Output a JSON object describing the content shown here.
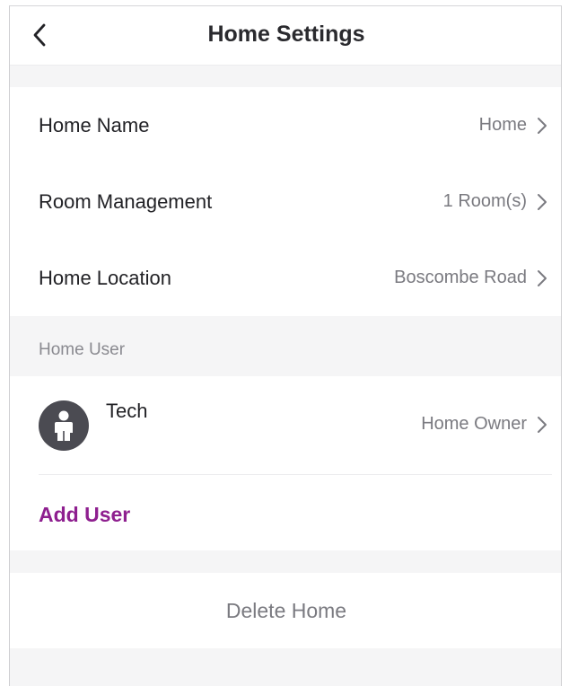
{
  "header": {
    "title": "Home Settings",
    "back_icon": "chevron-left-icon"
  },
  "settings": {
    "items": [
      {
        "label": "Home Name",
        "value": "Home"
      },
      {
        "label": "Room Management",
        "value": "1 Room(s)"
      },
      {
        "label": "Home Location",
        "value": "Boscombe Road"
      }
    ]
  },
  "users": {
    "section_title": "Home User",
    "list": [
      {
        "name": "Tech",
        "role": "Home Owner",
        "avatar_icon": "person-icon"
      }
    ],
    "add_user_label": "Add User"
  },
  "actions": {
    "delete_home_label": "Delete Home"
  },
  "colors": {
    "accent": "#8e1f8f",
    "page_bg": "#f5f5f6",
    "avatar_bg": "#4b4b52"
  }
}
